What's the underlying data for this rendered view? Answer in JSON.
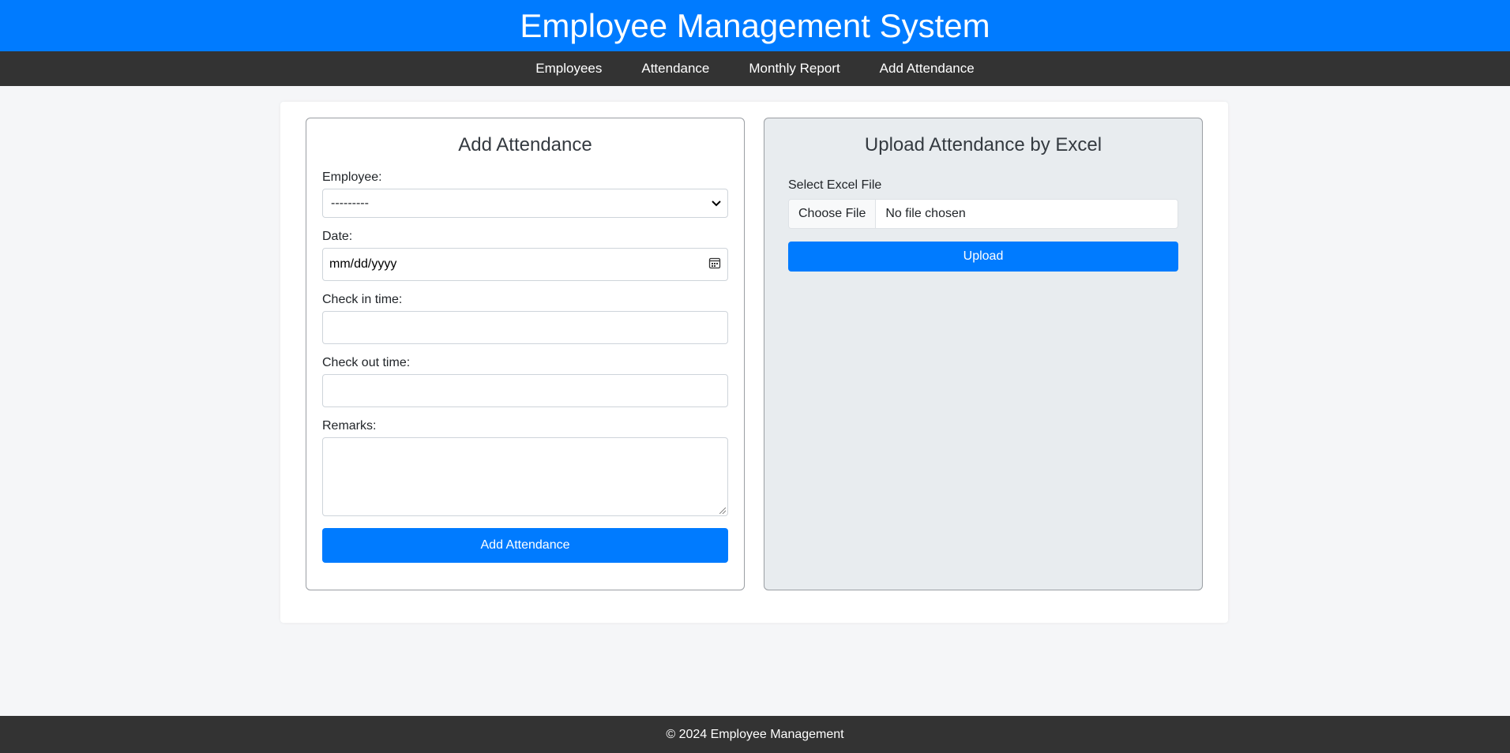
{
  "header": {
    "title": "Employee Management System"
  },
  "nav": {
    "items": [
      {
        "label": "Employees"
      },
      {
        "label": "Attendance"
      },
      {
        "label": "Monthly Report"
      },
      {
        "label": "Add Attendance"
      }
    ]
  },
  "add_form": {
    "title": "Add Attendance",
    "employee_label": "Employee:",
    "employee_value": "---------",
    "date_label": "Date:",
    "date_placeholder": "mm/dd/yyyy",
    "check_in_label": "Check in time:",
    "check_out_label": "Check out time:",
    "remarks_label": "Remarks:",
    "submit_label": "Add Attendance"
  },
  "upload_form": {
    "title": "Upload Attendance by Excel",
    "file_label": "Select Excel File",
    "choose_file_label": "Choose File",
    "file_status": "No file chosen",
    "upload_label": "Upload"
  },
  "footer": {
    "text": "© 2024 Employee Management"
  },
  "colors": {
    "primary": "#007bff",
    "dark_bar": "#333333",
    "upload_panel_bg": "#e8ecef"
  }
}
